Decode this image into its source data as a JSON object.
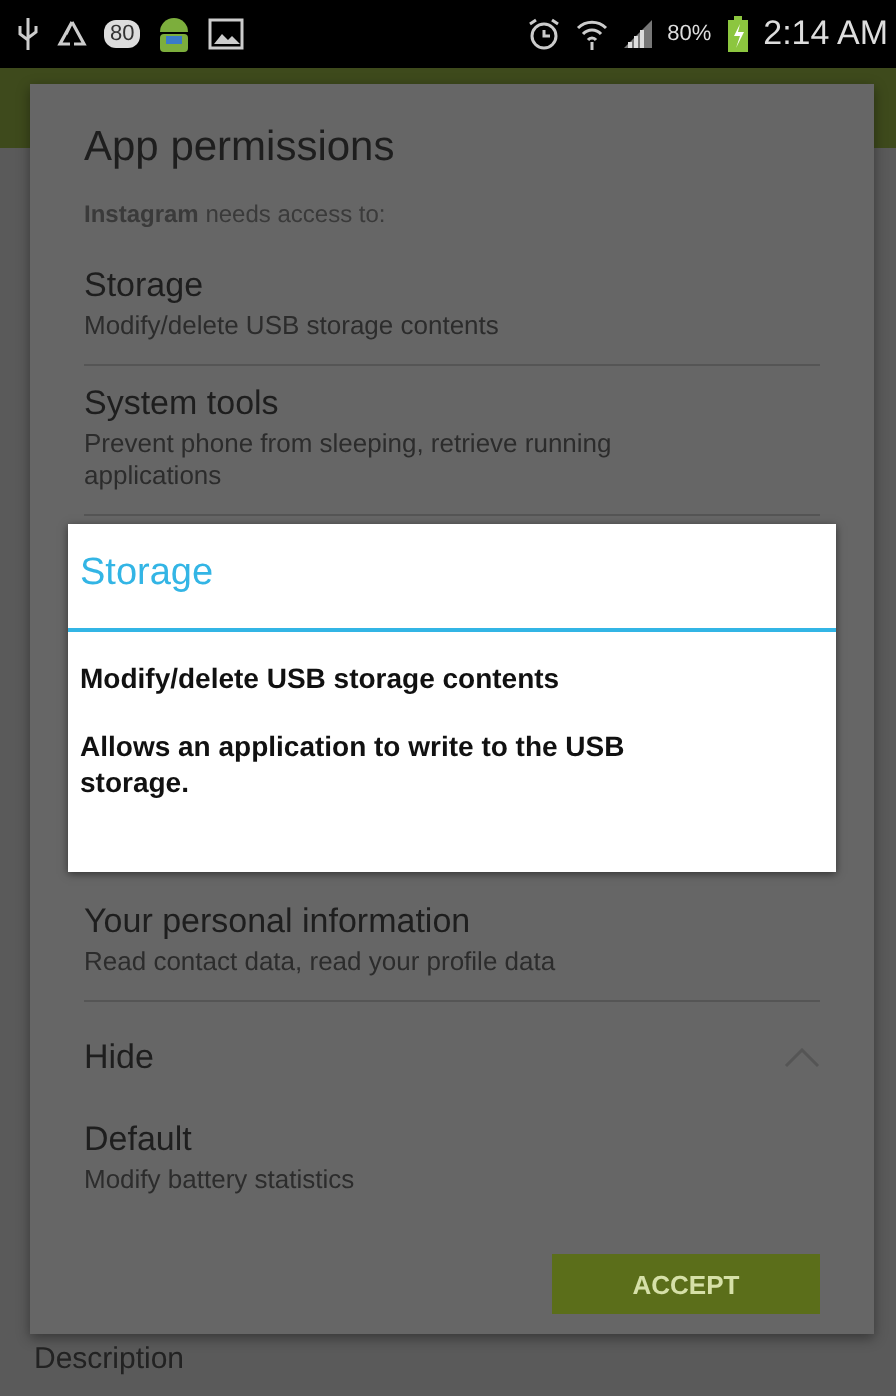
{
  "status_bar": {
    "notification_badge": "80",
    "battery_percent": "80%",
    "time": "2:14 AM"
  },
  "dialog": {
    "title": "App permissions",
    "intro": "**Instagram** needs access to:",
    "groups_above": [
      {
        "name": "Storage",
        "detail": "Modify/delete USB storage contents"
      },
      {
        "name": "System tools",
        "detail": "Prevent phone from sleeping, retrieve running applications"
      }
    ],
    "groups_below": [
      {
        "name": "Your personal information",
        "detail": "Read contact data, read your profile data"
      }
    ],
    "toggle": {
      "label": "Hide",
      "expanded": true
    },
    "extra_groups": [
      {
        "name": "Default",
        "detail": "Modify battery statistics"
      }
    ],
    "accept_button": "ACCEPT"
  },
  "popup": {
    "title": "Storage",
    "permission": "Modify/delete USB storage contents",
    "description": "Allows an application to write to the USB storage."
  },
  "background": {
    "footer_heading": "Description"
  }
}
